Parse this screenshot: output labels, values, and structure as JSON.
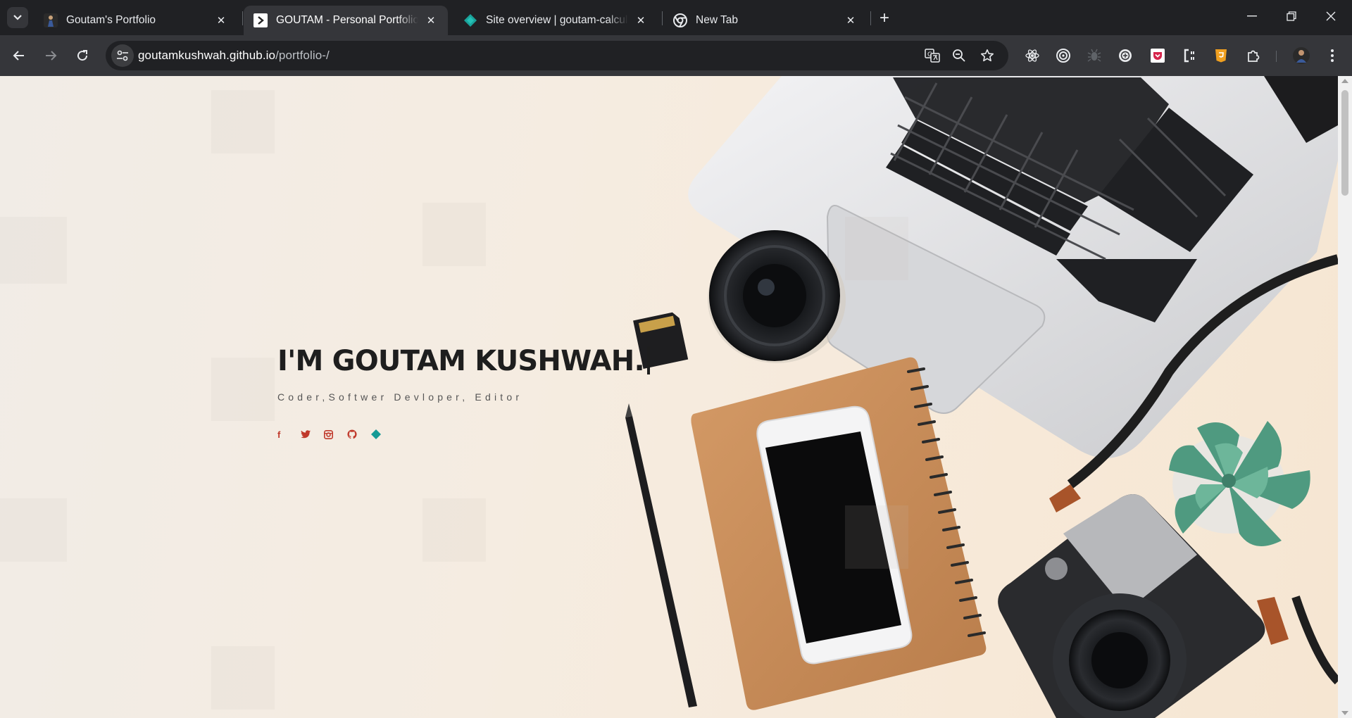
{
  "browser": {
    "tabs": [
      {
        "title": "Goutam's Portfolio",
        "favicon": "person-photo-icon",
        "active": false
      },
      {
        "title": "GOUTAM - Personal Portfolio Template",
        "favicon": "page-logo-icon",
        "active": true
      },
      {
        "title": "Site overview | goutam-calculator",
        "favicon": "netlify-diamond-icon",
        "active": false
      },
      {
        "title": "New Tab",
        "favicon": "chrome-icon",
        "active": false
      }
    ],
    "close_glyph": "✕",
    "new_tab_glyph": "+",
    "window_controls": {
      "minimize": "—",
      "restore": "❐",
      "close": "✕"
    },
    "address": {
      "host": "goutamkushwah.github.io",
      "path": "/portfolio-/"
    }
  },
  "hero": {
    "title": "I'M GOUTAM KUSHWAH.",
    "subtitle": "Coder,Softwer Devloper, Editor",
    "socials": [
      {
        "name": "facebook",
        "glyph": "f",
        "color": "#c0392b"
      },
      {
        "name": "twitter",
        "glyph": "twitter-bird-icon",
        "color": "#c0392b"
      },
      {
        "name": "instagram",
        "glyph": "instagram-icon",
        "color": "#c0392b"
      },
      {
        "name": "github",
        "glyph": "github-icon",
        "color": "#c0392b"
      },
      {
        "name": "netlify",
        "glyph": "diamond-icon",
        "color": "#159a95"
      }
    ]
  },
  "colors": {
    "tabstrip": "#202124",
    "toolbar": "#35363a",
    "page_bg": "#f3ebe3",
    "title_text": "#1e1e1e",
    "social_red": "#c0392b",
    "social_teal": "#159a95"
  }
}
